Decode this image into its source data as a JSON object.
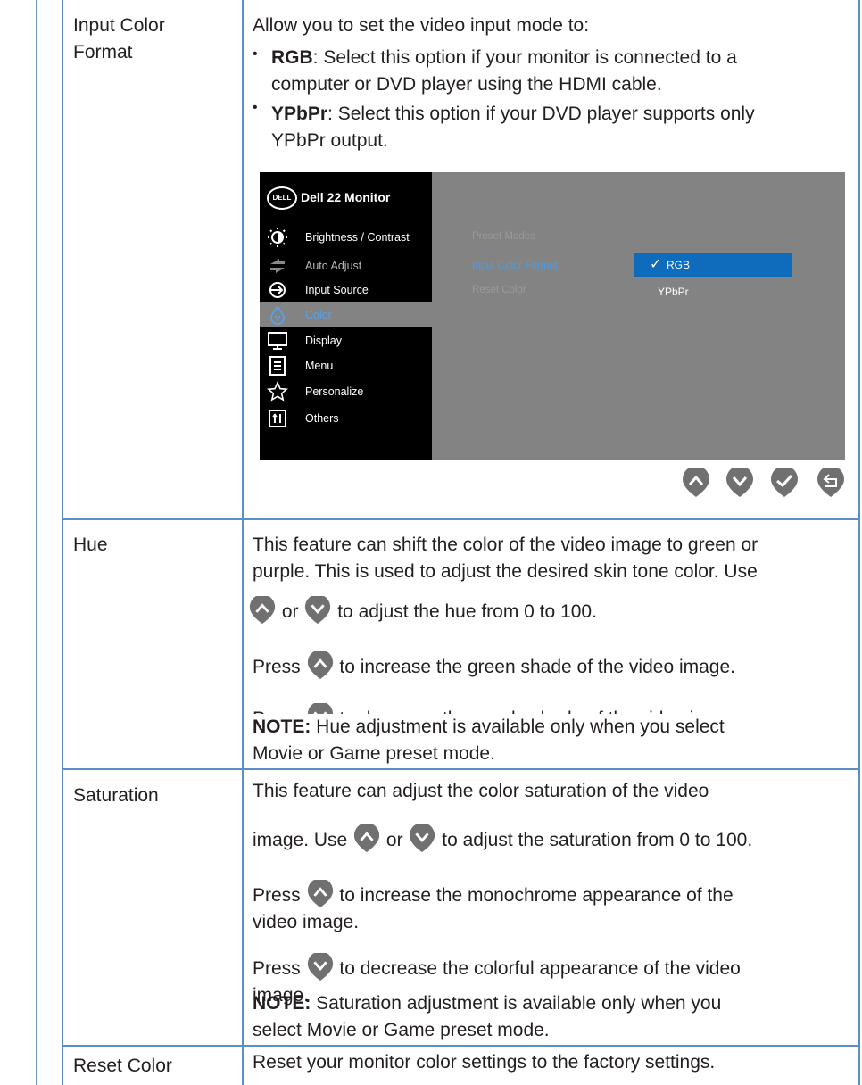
{
  "rows": {
    "input_color_format": {
      "label_line1": "Input Color",
      "label_line2": "Format",
      "intro": "Allow you to set the video input mode to:",
      "bullet_rgb_term": "RGB",
      "bullet_rgb_line1": ": Select this option if your monitor is connected to a",
      "bullet_rgb_line2": "computer or DVD player using the HDMI cable.",
      "bullet_ypbpr_term": "YPbPr",
      "bullet_ypbpr_line1": ": Select this option if your DVD player supports only",
      "bullet_ypbpr_line2": "YPbPr output."
    },
    "hue": {
      "label": "Hue",
      "line1": "This feature can shift the color of the video image to green or",
      "line2": "purple. This is used to adjust the desired skin tone color. Use",
      "line3_or": "or",
      "line3_rest": "to adjust the hue from 0 to 100.",
      "press": "Press",
      "press_up_rest": "to increase the green shade of the video image.",
      "press_down_rest": "to decrease the purple shade of the video image.",
      "note_label": "NOTE:",
      "note_line1": " Hue adjustment is available only when you select",
      "note_line2": "Movie or Game preset mode."
    },
    "saturation": {
      "label": "Saturation",
      "line1": "This feature can adjust the color saturation of the video",
      "line2_pre": "image. Use",
      "line2_or": "or",
      "line2_rest": "to adjust the saturation from 0 to 100.",
      "press": "Press",
      "press_up_rest": "to increase the monochrome appearance of the",
      "press_up_line2": "video image.",
      "press_down_rest": "to decrease the colorful appearance of the video",
      "press_down_line2": "image.",
      "note_label": "NOTE:",
      "note_line1": " Saturation adjustment is available only when you",
      "note_line2": "select Movie or Game preset mode."
    },
    "reset_color": {
      "label": "Reset Color",
      "text": "Reset your monitor color settings to the factory settings."
    }
  },
  "osd": {
    "logo": "DELL",
    "title": "Dell 22 Monitor",
    "menu": [
      {
        "label": "Brightness / Contrast",
        "icon": "brightness-icon"
      },
      {
        "label": "Auto Adjust",
        "icon": "auto-adjust-icon"
      },
      {
        "label": "Input Source",
        "icon": "input-source-icon"
      },
      {
        "label": "Color",
        "icon": "color-icon"
      },
      {
        "label": "Display",
        "icon": "display-icon"
      },
      {
        "label": "Menu",
        "icon": "menu-icon"
      },
      {
        "label": "Personalize",
        "icon": "personalize-icon"
      },
      {
        "label": "Others",
        "icon": "others-icon"
      }
    ],
    "submenu": [
      "Preset Modes",
      "Input Color Format",
      "Reset Color"
    ],
    "options": [
      "RGB",
      "YPbPr"
    ],
    "selected_option": "RGB",
    "check": "✓"
  },
  "nav_buttons": [
    "up-button",
    "down-button",
    "ok-button",
    "back-button"
  ],
  "colors": {
    "table_border": "#5b8ec4",
    "osd_panel": "#838383",
    "osd_highlight": "#0f6cbd",
    "osd_active_text": "#5aa1e6",
    "button_gray": "#707070"
  }
}
